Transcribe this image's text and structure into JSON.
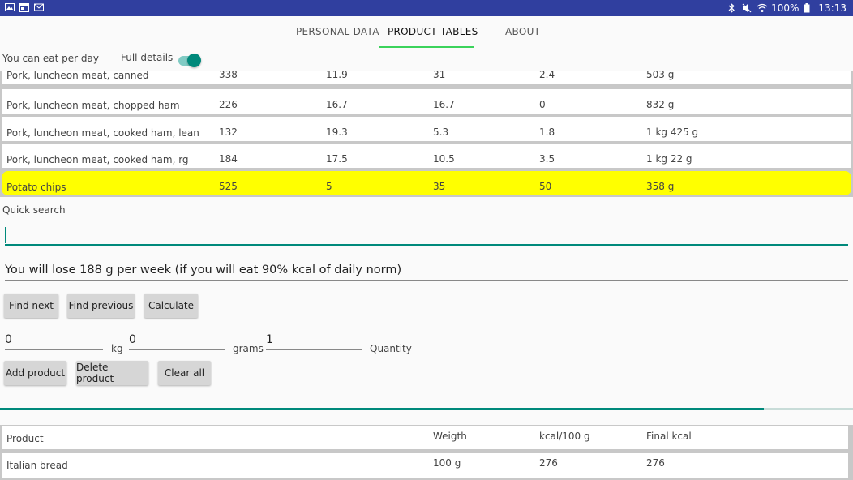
{
  "status": {
    "battery": "100%",
    "time": "13:13",
    "left_icons": [
      "image-icon",
      "calendar-icon",
      "gmail-icon"
    ],
    "right_icons": [
      "bluetooth-icon",
      "mute-icon",
      "wifi-icon",
      "battery-icon"
    ]
  },
  "tabs": [
    {
      "label": "PERSONAL DATA",
      "active": false
    },
    {
      "label": "PRODUCT TABLES",
      "active": true
    },
    {
      "label": "ABOUT",
      "active": false
    }
  ],
  "top": {
    "eat_label": "You can eat per day",
    "full_details_label": "Full details",
    "full_details_on": true
  },
  "products": [
    {
      "name": "Pork, luncheon meat, canned",
      "kcal": "338",
      "protein": "11.9",
      "fat": "31",
      "carbs": "2.4",
      "amount": "503 g"
    },
    {
      "name": "Pork, luncheon meat, chopped ham",
      "kcal": "226",
      "protein": "16.7",
      "fat": "16.7",
      "carbs": "0",
      "amount": "832 g"
    },
    {
      "name": "Pork, luncheon meat, cooked ham, lean",
      "kcal": "132",
      "protein": "19.3",
      "fat": "5.3",
      "carbs": "1.8",
      "amount": "1 kg 425 g"
    },
    {
      "name": "Pork, luncheon meat, cooked ham, rg",
      "kcal": "184",
      "protein": "17.5",
      "fat": "10.5",
      "carbs": "3.5",
      "amount": "1 kg 22 g"
    },
    {
      "name": "Potato chips",
      "kcal": "525",
      "protein": "5",
      "fat": "35",
      "carbs": "50",
      "amount": "358 g",
      "highlighted": true
    }
  ],
  "search": {
    "label": "Quick search",
    "value": ""
  },
  "result_text": "You will lose 188 g per week (if you will eat 90% kcal of daily norm)",
  "buttons": {
    "find_next": "Find next",
    "find_previous": "Find previous",
    "calculate": "Calculate",
    "add_product": "Add product",
    "delete_product": "Delete product",
    "clear_all": "Clear all"
  },
  "quantity": {
    "kg_value": "0",
    "kg_label": "kg",
    "grams_value": "0",
    "grams_label": "grams",
    "qty_value": "1",
    "qty_label": "Quantity"
  },
  "progress": 0.895,
  "selected": {
    "headers": [
      "Product",
      "Weigth",
      "kcal/100 g",
      "Final kcal"
    ],
    "rows": [
      {
        "product": "Italian bread",
        "weight": "100 g",
        "kcal100": "276",
        "final": "276"
      }
    ]
  },
  "colors": {
    "statusbar": "#303f9f",
    "accent": "#00897b",
    "tab_indicator": "#3bd35b",
    "highlight": "#ffff00"
  }
}
